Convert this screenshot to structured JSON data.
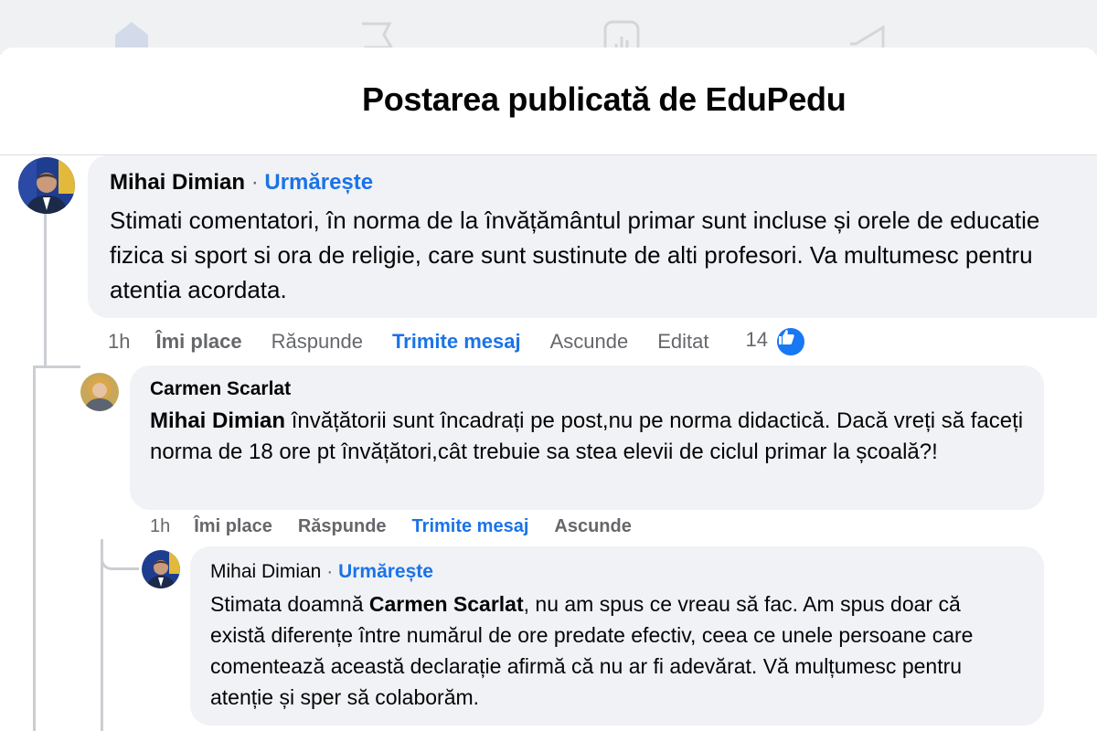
{
  "header": {
    "title": "Postarea publicată de EduPedu"
  },
  "comments": [
    {
      "author": "Mihai Dimian",
      "separator": "·",
      "follow_label": "Urmărește",
      "text": "Stimati comentatori, în norma de la învățământul primar sunt incluse și orele de educatie fizica si sport si ora de religie, care sunt sustinute de alti profesori. Va multumesc pentru atentia acordata.",
      "actions": {
        "time": "1h",
        "like": "Îmi place",
        "reply": "Răspunde",
        "message": "Trimite mesaj",
        "hide": "Ascunde",
        "edited": "Editat",
        "like_count": "14"
      }
    },
    {
      "author": "Carmen Scarlat",
      "mention": "Mihai Dimian",
      "text": " învățătorii sunt încadrați pe post,nu pe norma didactică. Dacă vreți să faceți norma de 18 ore pt învățători,cât trebuie sa stea elevii de ciclul primar la școală?!",
      "actions": {
        "time": "1h",
        "like": "Îmi place",
        "reply": "Răspunde",
        "message": "Trimite mesaj",
        "hide": "Ascunde"
      }
    },
    {
      "author": "Mihai Dimian",
      "separator": "·",
      "follow_label": "Urmărește",
      "text_before": "Stimata doamnă ",
      "mention": "Carmen Scarlat",
      "text_after": ", nu am spus ce vreau să fac. Am spus doar că există diferențe între numărul de ore predate efectiv, ceea ce unele persoane care comentează această declarație afirmă că nu ar fi adevărat. Vă mulțumesc pentru atenție și sper să colaborăm."
    }
  ],
  "colors": {
    "accent": "#1a73e8",
    "bubble": "#f0f2f5",
    "muted": "#65676b",
    "like_badge": "#1877f2"
  },
  "icons": [
    "home-icon",
    "flag-icon",
    "dashboard-icon",
    "megaphone-icon",
    "like-icon",
    "avatar-mihai-dimian",
    "avatar-carmen-scarlat"
  ]
}
